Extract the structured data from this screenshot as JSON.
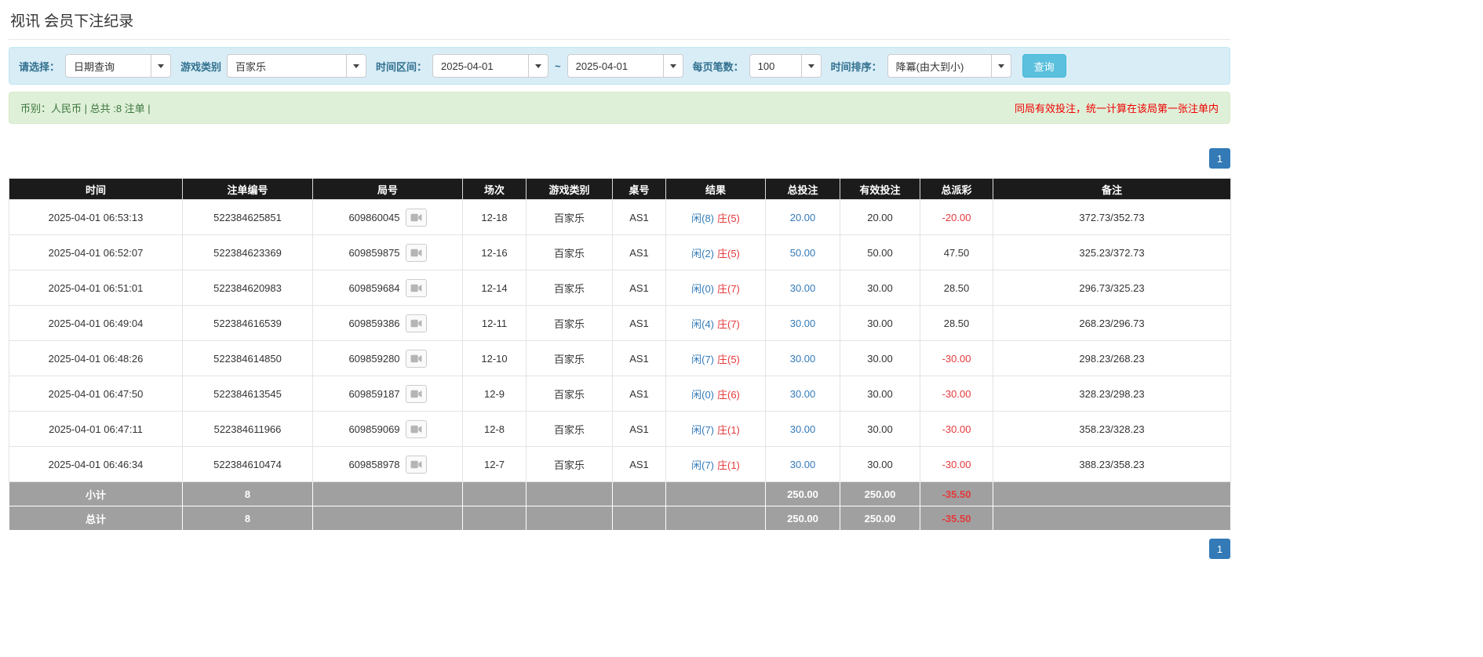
{
  "page": {
    "title": "视讯 会员下注纪录"
  },
  "filters": {
    "select_label": "请选择：",
    "select_value": "日期查询",
    "game_type_label": "游戏类别",
    "game_type_value": "百家乐",
    "time_range_label": "时间区间：",
    "date_from": "2025-04-01",
    "range_separator": "~",
    "date_to": "2025-04-01",
    "per_page_label": "每页笔数：",
    "per_page_value": "100",
    "sort_label": "时间排序：",
    "sort_value": "降冪(由大到小)",
    "search_button_label": "查询"
  },
  "summary": {
    "left_text": "币别：人民币 | 总共 :8 注单 |",
    "right_notice": "同局有效投注，统一计算在该局第一张注单内"
  },
  "pagination": {
    "current_page": "1"
  },
  "table": {
    "headers": [
      "时间",
      "注单编号",
      "局号",
      "场次",
      "游戏类别",
      "桌号",
      "结果",
      "总投注",
      "有效投注",
      "总派彩",
      "备注"
    ],
    "rows": [
      {
        "time": "2025-04-01 06:53:13",
        "bet_id": "522384625851",
        "round": "609860045",
        "session": "12-18",
        "game": "百家乐",
        "table_no": "AS1",
        "player": "闲(8)",
        "banker": "庄(5)",
        "total_bet": "20.00",
        "valid_bet": "20.00",
        "payout": "-20.00",
        "note": "372.73/352.73"
      },
      {
        "time": "2025-04-01 06:52:07",
        "bet_id": "522384623369",
        "round": "609859875",
        "session": "12-16",
        "game": "百家乐",
        "table_no": "AS1",
        "player": "闲(2)",
        "banker": "庄(5)",
        "total_bet": "50.00",
        "valid_bet": "50.00",
        "payout": "47.50",
        "note": "325.23/372.73"
      },
      {
        "time": "2025-04-01 06:51:01",
        "bet_id": "522384620983",
        "round": "609859684",
        "session": "12-14",
        "game": "百家乐",
        "table_no": "AS1",
        "player": "闲(0)",
        "banker": "庄(7)",
        "total_bet": "30.00",
        "valid_bet": "30.00",
        "payout": "28.50",
        "note": "296.73/325.23"
      },
      {
        "time": "2025-04-01 06:49:04",
        "bet_id": "522384616539",
        "round": "609859386",
        "session": "12-11",
        "game": "百家乐",
        "table_no": "AS1",
        "player": "闲(4)",
        "banker": "庄(7)",
        "total_bet": "30.00",
        "valid_bet": "30.00",
        "payout": "28.50",
        "note": "268.23/296.73"
      },
      {
        "time": "2025-04-01 06:48:26",
        "bet_id": "522384614850",
        "round": "609859280",
        "session": "12-10",
        "game": "百家乐",
        "table_no": "AS1",
        "player": "闲(7)",
        "banker": "庄(5)",
        "total_bet": "30.00",
        "valid_bet": "30.00",
        "payout": "-30.00",
        "note": "298.23/268.23"
      },
      {
        "time": "2025-04-01 06:47:50",
        "bet_id": "522384613545",
        "round": "609859187",
        "session": "12-9",
        "game": "百家乐",
        "table_no": "AS1",
        "player": "闲(0)",
        "banker": "庄(6)",
        "total_bet": "30.00",
        "valid_bet": "30.00",
        "payout": "-30.00",
        "note": "328.23/298.23"
      },
      {
        "time": "2025-04-01 06:47:11",
        "bet_id": "522384611966",
        "round": "609859069",
        "session": "12-8",
        "game": "百家乐",
        "table_no": "AS1",
        "player": "闲(7)",
        "banker": "庄(1)",
        "total_bet": "30.00",
        "valid_bet": "30.00",
        "payout": "-30.00",
        "note": "358.23/328.23"
      },
      {
        "time": "2025-04-01 06:46:34",
        "bet_id": "522384610474",
        "round": "609858978",
        "session": "12-7",
        "game": "百家乐",
        "table_no": "AS1",
        "player": "闲(7)",
        "banker": "庄(1)",
        "total_bet": "30.00",
        "valid_bet": "30.00",
        "payout": "-30.00",
        "note": "388.23/358.23"
      }
    ],
    "subtotal": {
      "label": "小计",
      "count": "8",
      "total_bet": "250.00",
      "valid_bet": "250.00",
      "payout": "-35.50"
    },
    "grand_total": {
      "label": "总计",
      "count": "8",
      "total_bet": "250.00",
      "valid_bet": "250.00",
      "payout": "-35.50"
    }
  },
  "icons": {
    "video_icon": "video-camera",
    "caret_icon": "chevron-down"
  },
  "colors": {
    "filter_bar_bg": "#d9edf7",
    "filter_label_text": "#31708f",
    "summary_bar_bg": "#dff0d8",
    "summary_text": "#3c763d",
    "notice_red": "#ee0000",
    "table_header_bg": "#1b1b1b",
    "table_footer_bg": "#a0a0a0",
    "link_blue": "#337ab7",
    "player_blue": "#337ab7",
    "banker_red": "#e4393c",
    "negative_red": "#e4393c",
    "search_button_bg": "#5bc0de",
    "pager_active_bg": "#337ab7"
  }
}
